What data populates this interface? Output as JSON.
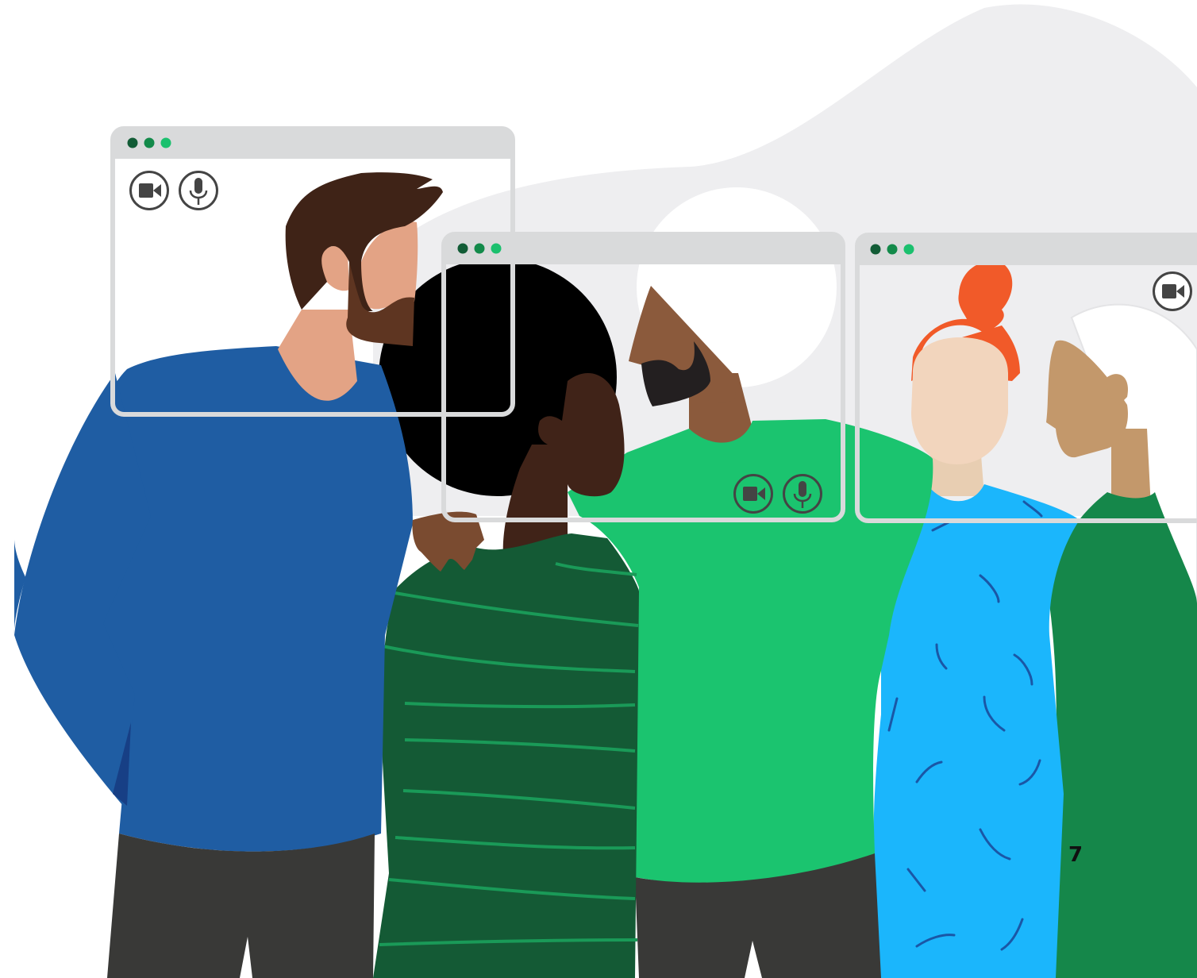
{
  "page": {
    "number": "7"
  },
  "palette": {
    "window_frame": "#d9dadb",
    "window_dot_1": "#125c36",
    "window_dot_2": "#138a4a",
    "window_dot_3": "#1bc06e",
    "icon_stroke": "#444444",
    "blob": "#eeeef0",
    "person_1_shirt": "#1f5da3",
    "person_2_shirt": "#145a35",
    "person_3_shirt": "#1bc46f",
    "person_4_shirt": "#1bb6fc",
    "person_5_shirt": "#15874a",
    "pants": "#393937"
  },
  "windows": [
    {
      "name": "video-window-1",
      "controls": [
        "camera-icon",
        "microphone-icon"
      ]
    },
    {
      "name": "video-window-2",
      "controls": [
        "camera-icon",
        "microphone-icon"
      ]
    },
    {
      "name": "video-window-3",
      "controls": [
        "camera-icon"
      ]
    }
  ]
}
